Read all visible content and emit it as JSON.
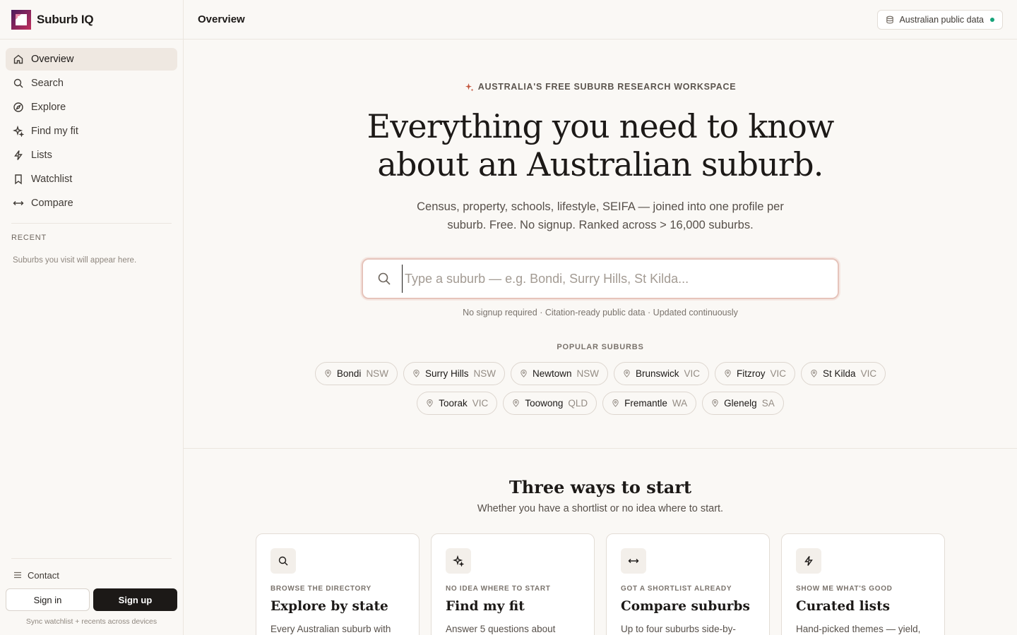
{
  "brand": {
    "name": "Suburb IQ"
  },
  "sidebar": {
    "items": [
      {
        "label": "Overview",
        "icon": "home-icon",
        "active": true
      },
      {
        "label": "Search",
        "icon": "search-icon"
      },
      {
        "label": "Explore",
        "icon": "compass-icon"
      },
      {
        "label": "Find my fit",
        "icon": "sparkles-icon"
      },
      {
        "label": "Lists",
        "icon": "lightning-icon"
      },
      {
        "label": "Watchlist",
        "icon": "bookmark-icon"
      },
      {
        "label": "Compare",
        "icon": "arrows-horizontal-icon"
      }
    ],
    "recent_label": "RECENT",
    "recent_empty": "Suburbs you visit will appear here.",
    "contact_label": "Contact",
    "sign_in": "Sign in",
    "sign_up": "Sign up",
    "sync_note": "Sync watchlist + recents across devices"
  },
  "header": {
    "title": "Overview",
    "data_pill": "Australian public data",
    "status_color": "#16a37a"
  },
  "hero": {
    "eyebrow": "AUSTRALIA'S FREE SUBURB RESEARCH WORKSPACE",
    "headline_line1": "Everything you need to know",
    "headline_line2": "about an Australian suburb.",
    "subtitle": "Census, property, schools, lifestyle, SEIFA — joined into one profile per suburb. Free. No signup. Ranked across > 16,000 suburbs.",
    "search_placeholder": "Type a suburb — e.g. Bondi, Surry Hills, St Kilda...",
    "search_value": "",
    "search_note": "No signup required · Citation-ready public data · Updated continuously",
    "popular_label": "POPULAR SUBURBS",
    "popular_row1": [
      {
        "name": "Bondi",
        "state": "NSW"
      },
      {
        "name": "Surry Hills",
        "state": "NSW"
      },
      {
        "name": "Newtown",
        "state": "NSW"
      },
      {
        "name": "Brunswick",
        "state": "VIC"
      },
      {
        "name": "Fitzroy",
        "state": "VIC"
      },
      {
        "name": "St Kilda",
        "state": "VIC"
      }
    ],
    "popular_row2": [
      {
        "name": "Toorak",
        "state": "VIC"
      },
      {
        "name": "Toowong",
        "state": "QLD"
      },
      {
        "name": "Fremantle",
        "state": "WA"
      },
      {
        "name": "Glenelg",
        "state": "SA"
      }
    ]
  },
  "ways": {
    "title": "Three ways to start",
    "subtitle": "Whether you have a shortlist or no idea where to start.",
    "cards": [
      {
        "kicker": "BROWSE THE DIRECTORY",
        "title": "Explore by state",
        "desc": "Every Australian suburb with",
        "icon": "search-icon"
      },
      {
        "kicker": "NO IDEA WHERE TO START",
        "title": "Find my fit",
        "desc": "Answer 5 questions about",
        "icon": "sparkles-icon"
      },
      {
        "kicker": "GOT A SHORTLIST ALREADY",
        "title": "Compare suburbs",
        "desc": "Up to four suburbs side-by-",
        "icon": "arrows-horizontal-icon"
      },
      {
        "kicker": "SHOW ME WHAT'S GOOD",
        "title": "Curated lists",
        "desc": "Hand-picked themes — yield,",
        "icon": "lightning-icon"
      }
    ]
  },
  "colors": {
    "accent": "#c2553c",
    "logo_primary": "#7a1d4e",
    "background": "#faf8f5"
  }
}
